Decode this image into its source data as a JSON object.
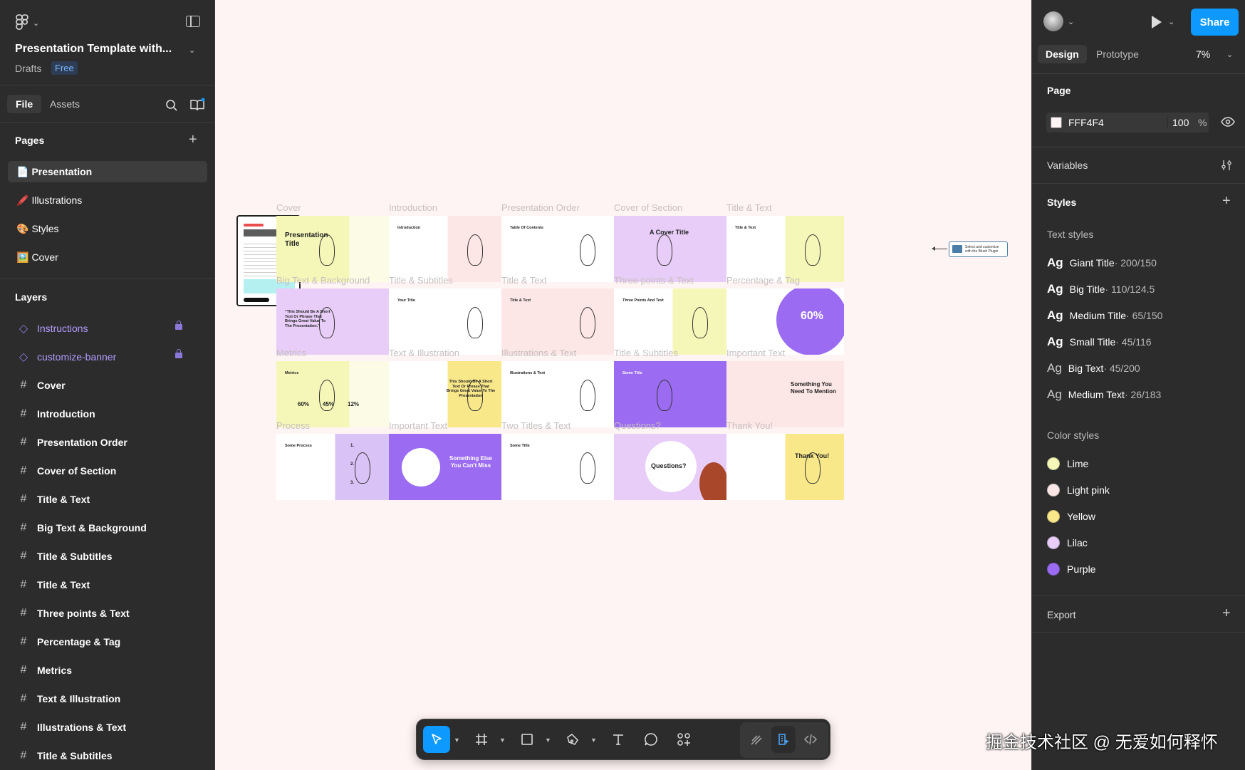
{
  "left_panel": {
    "file_title": "Presentation Template with...",
    "drafts": "Drafts",
    "plan_badge": "Free",
    "tabs": {
      "file": "File",
      "assets": "Assets"
    },
    "pages_header": "Pages",
    "pages": [
      {
        "icon": "📄",
        "label": "Presentation"
      },
      {
        "icon": "🖍️",
        "label": "Illustrations"
      },
      {
        "icon": "🎨",
        "label": "Styles"
      },
      {
        "icon": "🖼️",
        "label": "Cover"
      }
    ],
    "layers_header": "Layers",
    "layers": [
      {
        "type": "component",
        "label": "Instructions",
        "locked": true
      },
      {
        "type": "component",
        "label": "customize-banner",
        "locked": true
      },
      {
        "type": "frame",
        "label": "Cover"
      },
      {
        "type": "frame",
        "label": "Introduction"
      },
      {
        "type": "frame",
        "label": "Presentation Order"
      },
      {
        "type": "frame",
        "label": "Cover of Section"
      },
      {
        "type": "frame",
        "label": "Title & Text"
      },
      {
        "type": "frame",
        "label": "Big Text & Background"
      },
      {
        "type": "frame",
        "label": "Title & Subtitles"
      },
      {
        "type": "frame",
        "label": "Title & Text"
      },
      {
        "type": "frame",
        "label": "Three points & Text"
      },
      {
        "type": "frame",
        "label": "Percentage & Tag"
      },
      {
        "type": "frame",
        "label": "Metrics"
      },
      {
        "type": "frame",
        "label": "Text & Illustration"
      },
      {
        "type": "frame",
        "label": "Illustrations & Text"
      },
      {
        "type": "frame",
        "label": "Title & Subtitles"
      }
    ]
  },
  "right_panel": {
    "share_label": "Share",
    "tabs": {
      "design": "Design",
      "prototype": "Prototype"
    },
    "zoom": "7%",
    "page_header": "Page",
    "page_fill_hex": "FFF4F4",
    "page_fill_opacity": "100",
    "percent_sign": "%",
    "variables_header": "Variables",
    "styles_header": "Styles",
    "text_styles_header": "Text styles",
    "text_styles": [
      {
        "name": "Giant Title",
        "meta": " · 200/150",
        "bold": true
      },
      {
        "name": "Big Title",
        "meta": " · 110/124.5",
        "bold": true
      },
      {
        "name": "Medium Title",
        "meta": " · 65/150",
        "bold": true
      },
      {
        "name": "Small Title",
        "meta": " · 45/116",
        "bold": true
      },
      {
        "name": "Big Text",
        "meta": " · 45/200",
        "bold": false
      },
      {
        "name": "Medium Text",
        "meta": " · 26/183",
        "bold": false
      }
    ],
    "color_styles_header": "Color styles",
    "color_styles": [
      {
        "name": "Lime",
        "color": "#f4f7b8"
      },
      {
        "name": "Light pink",
        "color": "#fde6e6"
      },
      {
        "name": "Yellow",
        "color": "#f9e88a"
      },
      {
        "name": "Lilac",
        "color": "#e7cdf7"
      },
      {
        "name": "Purple",
        "color": "#9b6cf2"
      }
    ],
    "export_header": "Export",
    "ag_glyph": "Ag"
  },
  "canvas": {
    "background": "#fff4f4",
    "plugin_note": "Select and customize with the Blush Plugin",
    "slides": [
      {
        "label": "Cover",
        "bg": "lime-white",
        "text": "Presentation Title"
      },
      {
        "label": "Introduction",
        "bg": "white-pink",
        "text": "Introduction"
      },
      {
        "label": "Presentation Order",
        "bg": "white",
        "text": "Table Of Contents"
      },
      {
        "label": "Cover of Section",
        "bg": "lilac",
        "text": "A Cover Title"
      },
      {
        "label": "Title & Text",
        "bg": "white-lime",
        "text": "Title & Text"
      },
      {
        "label": "Big Text & Background",
        "bg": "lilac",
        "text": "\"This Should Be A Short Text Or Phrase That Brings Great Value To The Presentation.\""
      },
      {
        "label": "Title & Subtitles",
        "bg": "white",
        "text": "Your Title"
      },
      {
        "label": "Title & Text",
        "bg": "pink",
        "text": "Title & Text"
      },
      {
        "label": "Three points & Text",
        "bg": "white-lime",
        "text": "Three Points And Text"
      },
      {
        "label": "Percentage & Tag",
        "bg": "white-purple",
        "text": "60%"
      },
      {
        "label": "Metrics",
        "bg": "lime-white",
        "text": "Metrics",
        "metrics": [
          "60%",
          "45%",
          "12%"
        ]
      },
      {
        "label": "Text & Illustration",
        "bg": "white-yellow",
        "text": "This Should Be A Short Text Or Phrase That Brings Great Value To The Presentation"
      },
      {
        "label": "Illustrations & Text",
        "bg": "white",
        "text": "Illustrations & Text"
      },
      {
        "label": "Title & Subtitles",
        "bg": "purple",
        "text": "Some Title"
      },
      {
        "label": "Important Text",
        "bg": "pink",
        "text": "Something You Need To Mention"
      },
      {
        "label": "Process",
        "bg": "white-lilac",
        "text": "Some Process",
        "steps": [
          "1.",
          "2.",
          "3."
        ]
      },
      {
        "label": "Important Text",
        "bg": "purple",
        "text": "Something Else You Can't Miss"
      },
      {
        "label": "Two Titles & Text",
        "bg": "white",
        "text": "Some Title"
      },
      {
        "label": "Questions?",
        "bg": "lilac",
        "text": "Questions?"
      },
      {
        "label": "Thank You!",
        "bg": "white-yellow",
        "text": "Thank You!"
      }
    ]
  },
  "toolbar": {
    "tools": [
      "move-tool",
      "frame-tool",
      "shape-tool",
      "pen-tool",
      "text-tool",
      "comment-tool",
      "actions-tool",
      "draw-mode",
      "design-mode",
      "dev-mode"
    ]
  },
  "watermark": "掘金技术社区 @ 无爱如何释怀"
}
